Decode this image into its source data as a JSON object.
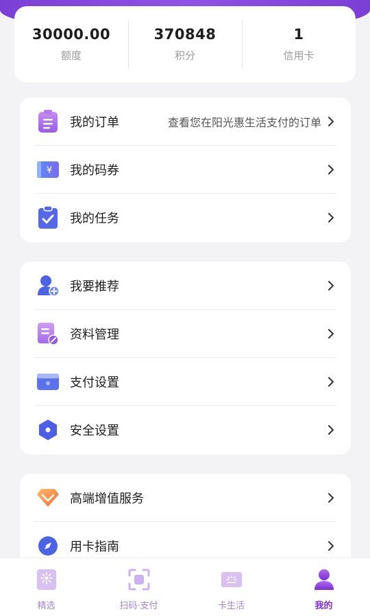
{
  "stats": [
    {
      "value": "30000.00",
      "label": "额度"
    },
    {
      "value": "370848",
      "label": "积分"
    },
    {
      "value": "1",
      "label": "信用卡"
    }
  ],
  "menu1": [
    {
      "label": "我的订单",
      "hint": "查看您在阳光惠生活支付的订单",
      "icon": "clipboard-icon"
    },
    {
      "label": "我的码券",
      "hint": "",
      "icon": "coupon-icon"
    },
    {
      "label": "我的任务",
      "hint": "",
      "icon": "task-check-icon"
    }
  ],
  "menu2": [
    {
      "label": "我要推荐",
      "hint": "",
      "icon": "add-user-icon"
    },
    {
      "label": "资料管理",
      "hint": "",
      "icon": "document-edit-icon"
    },
    {
      "label": "支付设置",
      "hint": "",
      "icon": "card-icon"
    },
    {
      "label": "安全设置",
      "hint": "",
      "icon": "shield-hexagon-icon"
    }
  ],
  "menu3": [
    {
      "label": "高端增值服务",
      "hint": "",
      "icon": "diamond-icon"
    },
    {
      "label": "用卡指南",
      "hint": "",
      "icon": "compass-icon"
    }
  ],
  "tabs": [
    {
      "label": "精选",
      "icon": "sparkle-icon",
      "active": false
    },
    {
      "label": "扫码·支付",
      "icon": "scan-icon",
      "active": false
    },
    {
      "label": "卡生活",
      "icon": "card-life-icon",
      "active": false
    },
    {
      "label": "我的",
      "icon": "profile-icon",
      "active": true
    }
  ],
  "colors": {
    "accent": "#7d2fd4",
    "tab_inactive": "#a584d8",
    "header": "#8f52e6"
  }
}
